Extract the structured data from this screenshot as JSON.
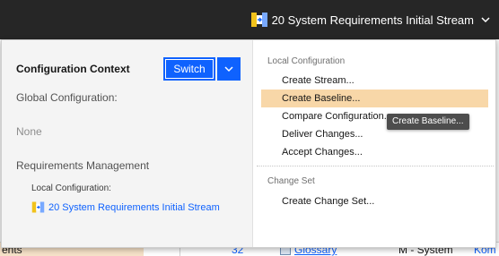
{
  "header": {
    "current_context": "20 System Requirements Initial Stream"
  },
  "panel": {
    "title": "Configuration Context",
    "switch_label": "Switch",
    "global_config_label": "Global Configuration:",
    "global_config_value": "None",
    "rm_label": "Requirements Management",
    "local_config_label": "Local Configuration:",
    "local_config_link": "20 System Requirements Initial Stream"
  },
  "menu": {
    "local_section": "Local Configuration",
    "items": [
      {
        "label": "Create Stream..."
      },
      {
        "label": "Create Baseline..."
      },
      {
        "label": "Compare Configuration..."
      },
      {
        "label": "Deliver Changes..."
      },
      {
        "label": "Accept Changes..."
      }
    ],
    "changeset_section": "Change Set",
    "changeset_items": [
      {
        "label": "Create Change Set..."
      }
    ]
  },
  "tooltip": "Create Baseline...",
  "background_row": {
    "col0": "ents",
    "col1": "32",
    "col3": "Glossary",
    "col4": "M - System",
    "col5": "Kom"
  },
  "colors": {
    "header_bg": "#262626",
    "accent": "#0f62fe",
    "highlight": "#f8d7a8",
    "tooltip_bg": "#4d4d4d"
  },
  "icons": {
    "context": "stream-icon",
    "dropdown": "chevron-down-icon"
  }
}
